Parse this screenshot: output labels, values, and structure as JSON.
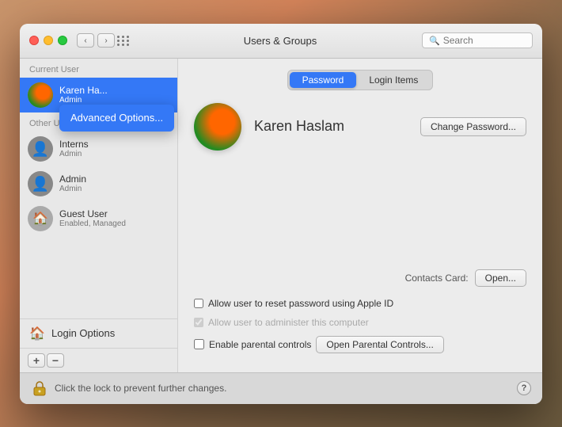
{
  "window": {
    "title": "Users & Groups"
  },
  "titlebar": {
    "back_btn": "‹",
    "forward_btn": "›",
    "search_placeholder": "Search"
  },
  "sidebar": {
    "current_user_label": "Current User",
    "other_users_label": "Other Users",
    "users": [
      {
        "id": "karen",
        "name": "Karen Ha...",
        "role": "Admin",
        "selected": true
      },
      {
        "id": "interns",
        "name": "Interns",
        "role": "Admin",
        "selected": false
      },
      {
        "id": "admin",
        "name": "Admin",
        "role": "Admin",
        "selected": false
      },
      {
        "id": "guest",
        "name": "Guest User",
        "role": "Enabled, Managed",
        "selected": false
      }
    ],
    "login_options_label": "Login Options",
    "add_btn": "+",
    "remove_btn": "−"
  },
  "dropdown": {
    "label": "Advanced Options..."
  },
  "main": {
    "tabs": [
      {
        "id": "password",
        "label": "Password",
        "active": true
      },
      {
        "id": "login_items",
        "label": "Login Items",
        "active": false
      }
    ],
    "user_name": "Karen Haslam",
    "change_password_btn": "Change Password...",
    "contacts_card_label": "Contacts Card:",
    "open_btn": "Open...",
    "checkbox1_label": "Allow user to reset password using Apple ID",
    "checkbox1_checked": false,
    "checkbox2_label": "Allow user to administer this computer",
    "checkbox2_checked": true,
    "checkbox2_disabled": true,
    "checkbox3_label": "Enable parental controls",
    "checkbox3_checked": false,
    "open_parental_btn": "Open Parental Controls..."
  },
  "bottom": {
    "lock_message": "Click the lock to prevent further changes.",
    "help_btn": "?"
  }
}
